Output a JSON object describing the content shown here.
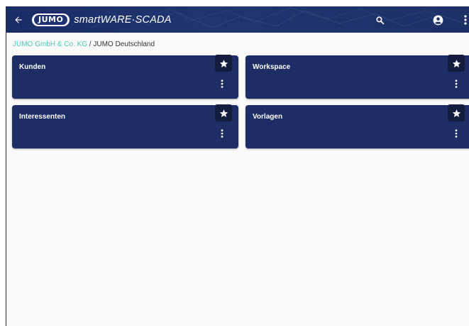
{
  "header": {
    "logo_text": "JUMO",
    "app_title": "smartWARE·SCADA",
    "colors": {
      "background": "#1d3068",
      "icon": "#ffffff"
    },
    "icons": [
      "back-arrow-icon",
      "search-icon",
      "account-icon",
      "more-vert-icon"
    ]
  },
  "breadcrumb": {
    "parent": "JUMO GmbH & Co. KG",
    "separator": " / ",
    "current": "JUMO Deutschland",
    "link_color": "#4cc7bd"
  },
  "cards": [
    {
      "label": "Kunden"
    },
    {
      "label": "Workspace"
    },
    {
      "label": "Interessenten"
    },
    {
      "label": "Vorlagen"
    }
  ],
  "card_colors": {
    "background": "#1d2d66",
    "star_background": "#141d3e",
    "text": "#ffffff"
  }
}
